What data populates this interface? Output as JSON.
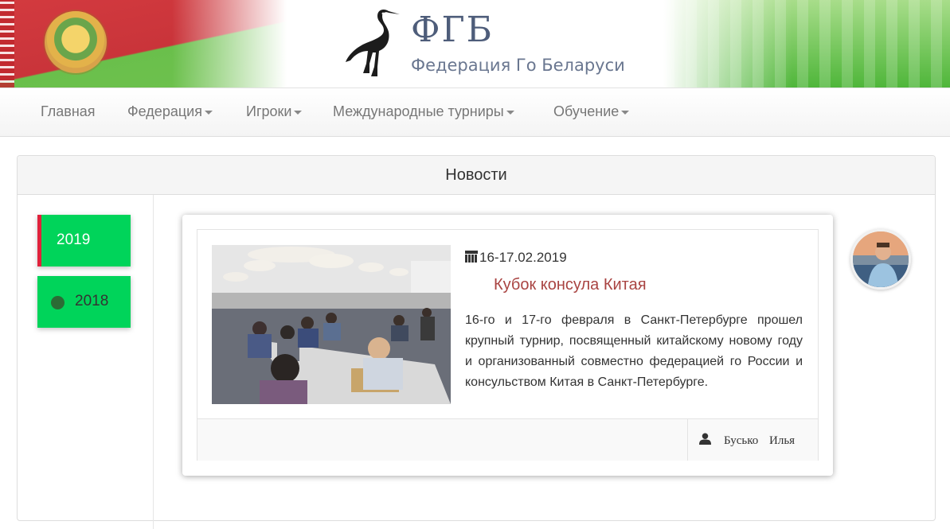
{
  "header": {
    "logo_abbr": "ФГБ",
    "logo_full": "Федерация Го Беларуси",
    "stork_icon": "stork-logo-icon",
    "emblem_icon": "belarus-emblem-icon"
  },
  "nav": {
    "items": [
      {
        "label": "Главная",
        "dropdown": false
      },
      {
        "label": "Федерация",
        "dropdown": true
      },
      {
        "label": "Игроки",
        "dropdown": true
      },
      {
        "label": "Международные турниры",
        "dropdown": true
      },
      {
        "label": "Обучение",
        "dropdown": true
      }
    ]
  },
  "panel": {
    "title": "Новости"
  },
  "years": {
    "active": "2019",
    "other": "2018"
  },
  "news": {
    "date": "16-17.02.2019",
    "title": "Кубок консула Китая",
    "body": "16-го и 17-го февраля в Санкт-Петербурге прошел крупный турнир, посвященный китайскому новому году и организованный совместно федерацией го России и консульством Китая в Санкт-Петербурге.",
    "author": "Бусько Илья",
    "icons": {
      "date": "calendar-icon",
      "author": "user-icon"
    }
  },
  "colors": {
    "accent_green": "#00d45a",
    "active_marker": "#e0223c",
    "news_title": "#a94442",
    "nav_text": "#777777"
  }
}
